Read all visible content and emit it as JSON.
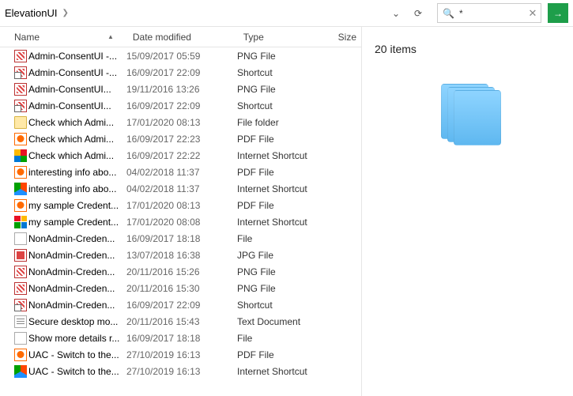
{
  "breadcrumb": {
    "current": "ElevationUI"
  },
  "search": {
    "query": "*"
  },
  "columns": {
    "name": "Name",
    "date": "Date modified",
    "type": "Type",
    "size": "Size"
  },
  "preview": {
    "count_text": "20 items"
  },
  "files": [
    {
      "name": "Admin-ConsentUI -...",
      "date": "15/09/2017 05:59",
      "type": "PNG File",
      "icon": "png"
    },
    {
      "name": "Admin-ConsentUI -...",
      "date": "16/09/2017 22:09",
      "type": "Shortcut",
      "icon": "png-shortcut"
    },
    {
      "name": "Admin-ConsentUI...",
      "date": "19/11/2016 13:26",
      "type": "PNG File",
      "icon": "png"
    },
    {
      "name": "Admin-ConsentUI...",
      "date": "16/09/2017 22:09",
      "type": "Shortcut",
      "icon": "png-shortcut"
    },
    {
      "name": "Check which Admi...",
      "date": "17/01/2020 08:13",
      "type": "File folder",
      "icon": "folder"
    },
    {
      "name": "Check which Admi...",
      "date": "16/09/2017 22:23",
      "type": "PDF File",
      "icon": "pdf"
    },
    {
      "name": "Check which Admi...",
      "date": "16/09/2017 22:22",
      "type": "Internet Shortcut",
      "icon": "edge"
    },
    {
      "name": "interesting info abo...",
      "date": "04/02/2018 11:37",
      "type": "PDF File",
      "icon": "pdf"
    },
    {
      "name": "interesting info abo...",
      "date": "04/02/2018 11:37",
      "type": "Internet Shortcut",
      "icon": "ff"
    },
    {
      "name": "my sample Credent...",
      "date": "17/01/2020 08:13",
      "type": "PDF File",
      "icon": "pdf"
    },
    {
      "name": "my sample Credent...",
      "date": "17/01/2020 08:08",
      "type": "Internet Shortcut",
      "icon": "multi"
    },
    {
      "name": "NonAdmin-Creden...",
      "date": "16/09/2017 18:18",
      "type": "File",
      "icon": "file"
    },
    {
      "name": "NonAdmin-Creden...",
      "date": "13/07/2018 16:38",
      "type": "JPG File",
      "icon": "jpg"
    },
    {
      "name": "NonAdmin-Creden...",
      "date": "20/11/2016 15:26",
      "type": "PNG File",
      "icon": "png"
    },
    {
      "name": "NonAdmin-Creden...",
      "date": "20/11/2016 15:30",
      "type": "PNG File",
      "icon": "png"
    },
    {
      "name": "NonAdmin-Creden...",
      "date": "16/09/2017 22:09",
      "type": "Shortcut",
      "icon": "png-shortcut"
    },
    {
      "name": "Secure desktop mo...",
      "date": "20/11/2016 15:43",
      "type": "Text Document",
      "icon": "txt"
    },
    {
      "name": "Show more details r...",
      "date": "16/09/2017 18:18",
      "type": "File",
      "icon": "file"
    },
    {
      "name": "UAC - Switch to the...",
      "date": "27/10/2019 16:13",
      "type": "PDF File",
      "icon": "pdf"
    },
    {
      "name": "UAC - Switch to the...",
      "date": "27/10/2019 16:13",
      "type": "Internet Shortcut",
      "icon": "ff"
    }
  ]
}
